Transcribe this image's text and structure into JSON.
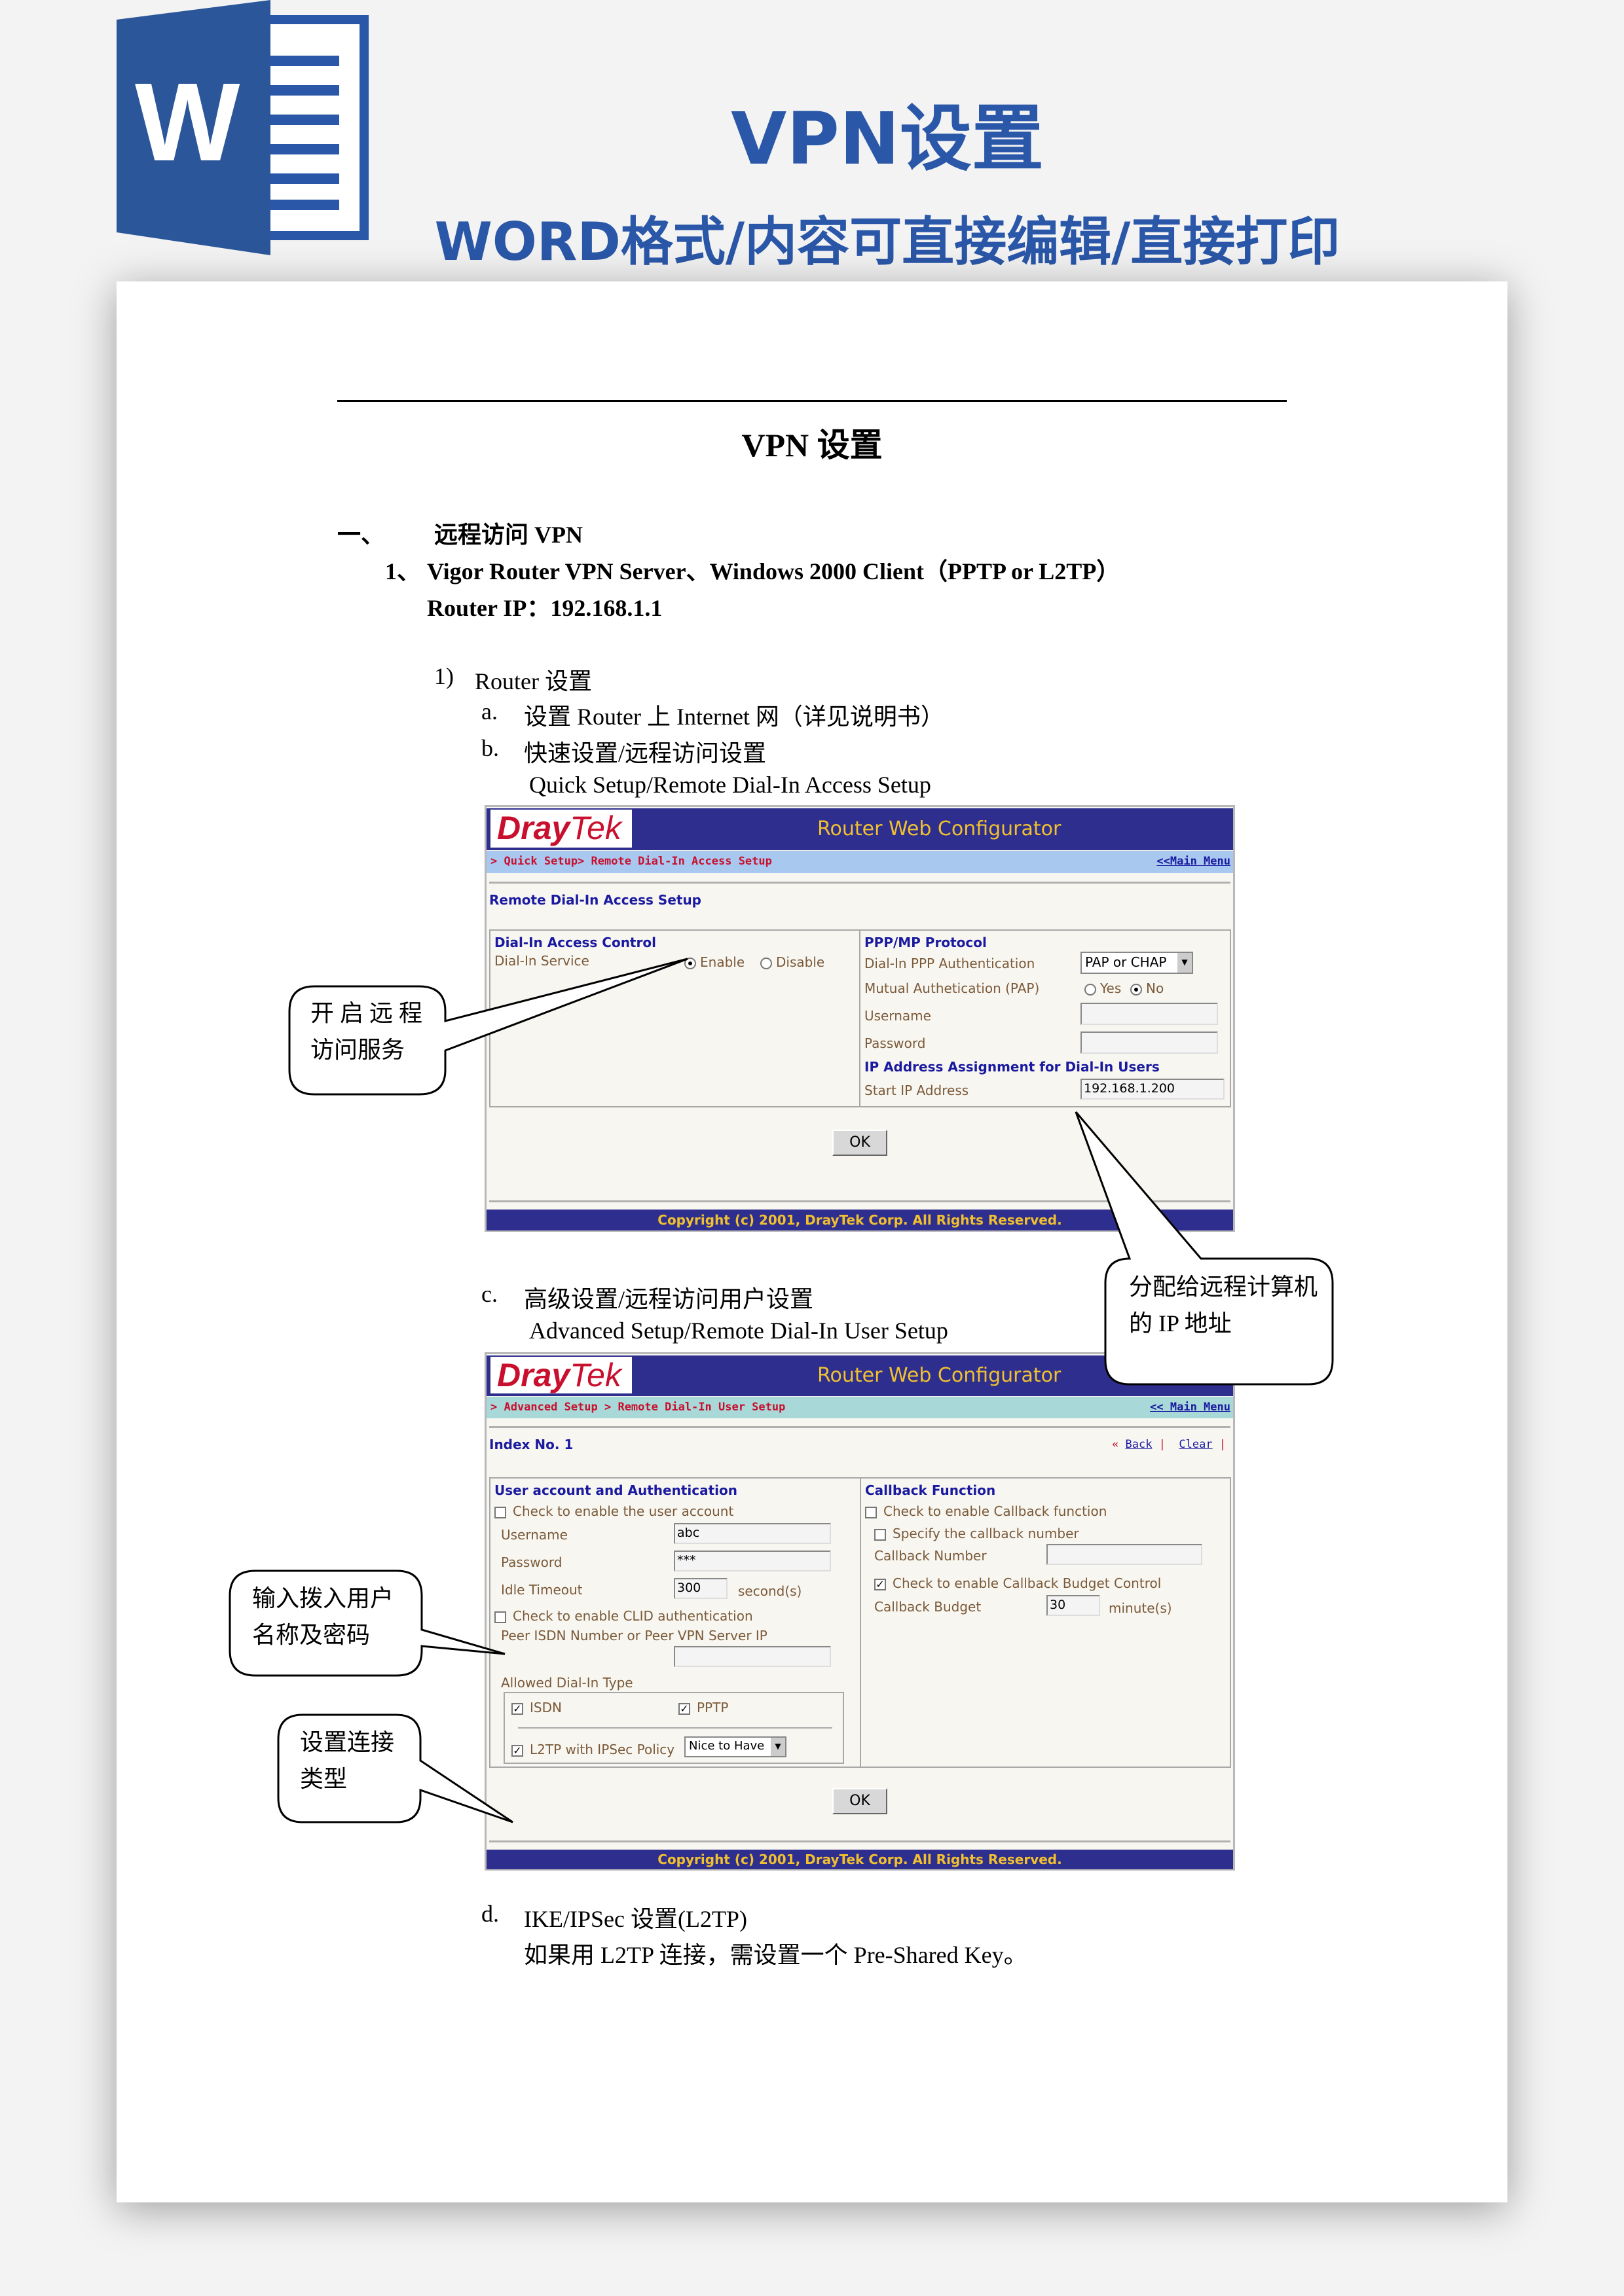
{
  "banner": {
    "title": "VPN设置",
    "subtitle": "WORD格式/内容可直接编辑/直接打印",
    "icon": "word-icon",
    "icon_letter": "W",
    "brand_color": "#2a57a8"
  },
  "doc": {
    "title": "VPN 设置",
    "section": {
      "num": "一、",
      "text": "远程访问 VPN"
    },
    "item1": {
      "num": "1、",
      "text": "Vigor Router VPN Server、Windows 2000 Client（PPTP or L2TP）"
    },
    "router_ip": "Router IP：192.168.1.1",
    "step1": {
      "num": "1)",
      "text": "Router  设置"
    },
    "a": {
      "num": "a.",
      "text": "设置 Router 上 Internet 网（详见说明书）"
    },
    "b": {
      "num": "b.",
      "text": "快速设置/远程访问设置",
      "en": "Quick Setup/Remote Dial-In Access Setup"
    },
    "c": {
      "num": "c.",
      "text": "高级设置/远程访问用户设置",
      "en": "Advanced Setup/Remote Dial-In User Setup"
    },
    "d": {
      "num": "d.",
      "text": "IKE/IPSec 设置(L2TP)",
      "line2": "如果用 L2TP 连接，需设置一个 Pre-Shared Key。"
    }
  },
  "callouts": [
    "开 启 远 程 访问服务",
    "分配给远程计算机的 IP 地址",
    "输入拨入用户名称及密码",
    "设置连接类型"
  ],
  "shot1": {
    "logo": {
      "dray": "Dray",
      "tek": "Tek"
    },
    "header": "Router Web Configurator",
    "crumb": "> Quick Setup> Remote Dial-In Access Setup",
    "main_menu": "<<Main Menu",
    "page_title": "Remote Dial-In Access Setup",
    "left": {
      "heading": "Dial-In Access Control",
      "service_label": "Dial-In Service",
      "enable": "Enable",
      "disable": "Disable",
      "enabled": true
    },
    "right": {
      "heading": "PPP/MP Protocol",
      "auth_label": "Dial-In PPP Authentication",
      "auth_value": "PAP or CHAP",
      "mutual_label": "Mutual Authetication (PAP)",
      "yes": "Yes",
      "no": "No",
      "mutual": "No",
      "username_label": "Username",
      "username": "",
      "password_label": "Password",
      "password": "",
      "ip_heading": "IP Address Assignment for Dial-In Users",
      "start_ip_label": "Start IP Address",
      "start_ip": "192.168.1.200"
    },
    "ok": "OK",
    "footer": "Copyright (c) 2001, DrayTek Corp. All Rights Reserved."
  },
  "shot2": {
    "logo": {
      "dray": "Dray",
      "tek": "Tek"
    },
    "header": "Router Web Configurator",
    "crumb": "> Advanced Setup > Remote Dial-In User Setup",
    "main_menu": "<< Main Menu",
    "index": "Index No. 1",
    "back": "Back",
    "clear": "Clear",
    "left": {
      "heading": "User account and Authentication",
      "enable_account": "Check to enable the user account",
      "username_label": "Username",
      "username": "abc",
      "password_label": "Password",
      "password": "***",
      "idle_label": "Idle Timeout",
      "idle": "300",
      "idle_unit": "second(s)",
      "clid": "Check to enable CLID authentication",
      "peer_label": "Peer ISDN Number or Peer VPN Server IP",
      "peer": "",
      "allowed_label": "Allowed Dial-In Type",
      "isdn": "ISDN",
      "pptp": "PPTP",
      "l2tp": "L2TP with IPSec Policy",
      "l2tp_policy": "Nice to Have"
    },
    "right": {
      "heading": "Callback Function",
      "enable_callback": "Check to enable Callback function",
      "specify": "Specify the callback number",
      "number_label": "Callback Number",
      "number": "",
      "budget_control": "Check to enable Callback Budget Control",
      "budget_label": "Callback Budget",
      "budget": "30",
      "budget_unit": "minute(s)"
    },
    "ok": "OK",
    "footer": "Copyright (c) 2001, DrayTek Corp. All Rights Reserved."
  }
}
